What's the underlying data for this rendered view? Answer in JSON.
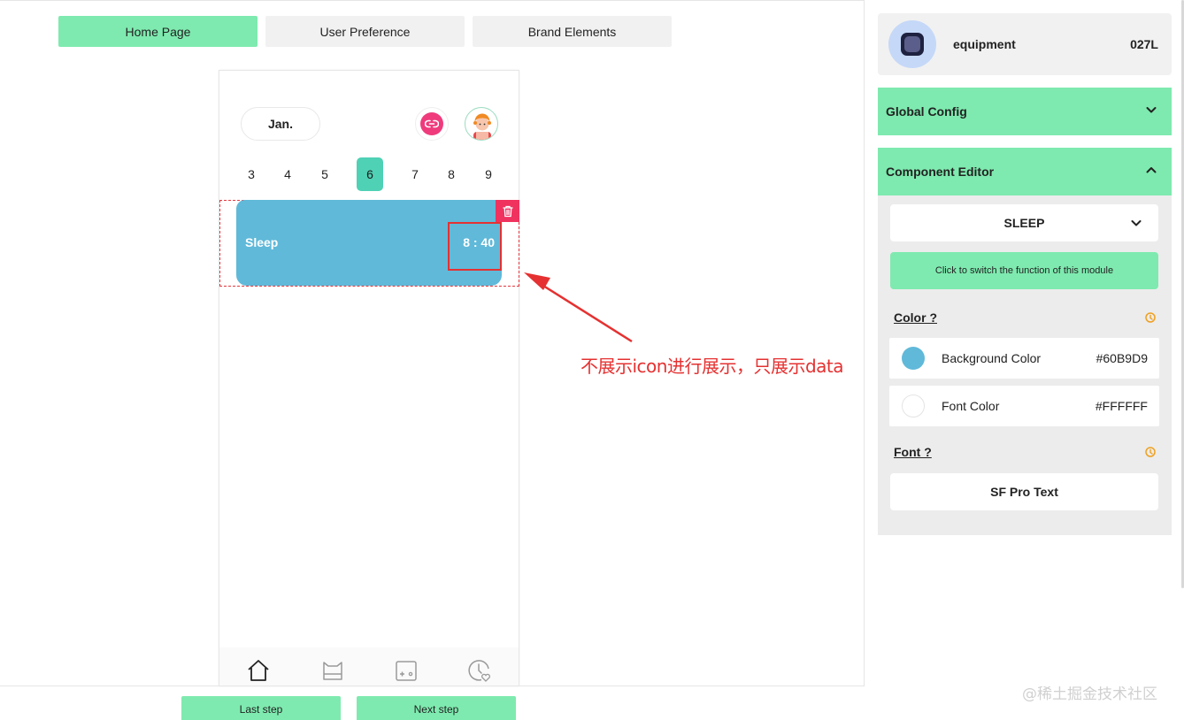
{
  "tabs": [
    {
      "label": "Home Page",
      "active": true
    },
    {
      "label": "User Preference",
      "active": false
    },
    {
      "label": "Brand Elements",
      "active": false
    }
  ],
  "phone": {
    "month": "Jan.",
    "days": [
      "3",
      "4",
      "5",
      "6",
      "7",
      "8",
      "9"
    ],
    "selected_day": "6",
    "module": {
      "label": "Sleep",
      "value": "8 : 40"
    }
  },
  "annotation": "不展示icon进行展示，只展示data",
  "footer": {
    "last_step": "Last step",
    "next_step": "Next step",
    "watermark": "@稀土掘金技术社区"
  },
  "right_panel": {
    "device": {
      "name": "equipment",
      "model": "027L"
    },
    "global_config": {
      "title": "Global Config",
      "expanded": false
    },
    "component_editor": {
      "title": "Component Editor",
      "expanded": true,
      "selected_function": "SLEEP",
      "switch_label": "Click to switch the function of this module",
      "color_section": "Color ?",
      "colors": [
        {
          "name": "Background Color",
          "hex": "#60B9D9"
        },
        {
          "name": "Font Color",
          "hex": "#FFFFFF"
        }
      ],
      "font_section": "Font ?",
      "font_value": "SF Pro Text"
    }
  },
  "colors": {
    "accent": "#7eeaaf",
    "module_bg": "#60b9d9",
    "delete": "#f0325f",
    "annotation": "#e53131",
    "day_active": "#4fd1b5"
  }
}
